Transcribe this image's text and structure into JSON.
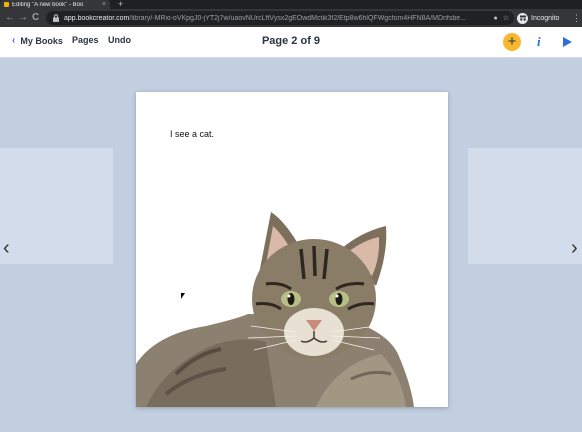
{
  "browser": {
    "tab_title": "Editing \"A new book\" - Boo",
    "tab_close": "×",
    "new_tab": "+",
    "url_host": "app.bookcreator.com",
    "url_path": "/library/-MRxi-oVKpgJ0-jYT2j7w/uaovNUrcLftVysx2gEOwdMctik3f2/Etp8w6hlQFWgcfom4HFN8A/MDnfsbe...",
    "nav": {
      "back": "←",
      "forward": "→",
      "reload": "C"
    },
    "incognito_label": "Incognito",
    "star": "☆",
    "menu": "⋮"
  },
  "appbar": {
    "back_label": "My Books",
    "back_chevron": "‹",
    "pages_label": "Pages",
    "undo_label": "Undo",
    "page_indicator": "Page 2 of 9",
    "add_label": "+",
    "info_label": "i"
  },
  "canvas": {
    "prev_arrow": "‹",
    "next_arrow": "›",
    "page_text": "I see a cat."
  },
  "colors": {
    "accent": "#2a6fdb",
    "add_button": "#f5b82e",
    "background": "#c2cfe0"
  }
}
